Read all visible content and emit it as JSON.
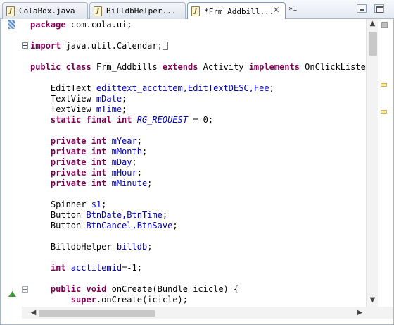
{
  "tabs": [
    {
      "label": "ColaBox.java",
      "icon": "java-file-icon",
      "active": false
    },
    {
      "label": "BilldbHelper...",
      "icon": "java-file-icon",
      "active": false
    },
    {
      "label": "*Frm_Addbill...",
      "icon": "java-file-icon",
      "active": true
    }
  ],
  "tab_overflow": "»1",
  "file_icon_glyph": "J",
  "close_glyph": "✕",
  "code": {
    "l1_kw": "package",
    "l1_rest": " com.cola.ui;",
    "l2_kw": "import",
    "l2_rest": " java.util.Calendar;",
    "l3_kw1": "public class",
    "l3_name": " Frm_Addbills ",
    "l3_kw2": "extends",
    "l3_mid": " Activity ",
    "l3_kw3": "implements",
    "l3_rest": " OnClickListener",
    "l4_type": "    EditText ",
    "l4_fields": "edittext_acctitem,EditTextDESC,Fee",
    "l4_end": ";",
    "l5_type": "    TextView ",
    "l5_field": "mDate",
    "l6_type": "    TextView ",
    "l6_field": "mTime",
    "l7_kw": "    static final int",
    "l7_field": " RG_REQUEST",
    "l7_rest": " = 0;",
    "private_kw": "    private int",
    "f_year": " mYear",
    "f_month": " mMonth",
    "f_day": " mDay",
    "f_hour": " mHour",
    "f_minute": " mMinute",
    "semi": ";",
    "l8_type": "    Spinner ",
    "l8_field": "s1",
    "l9_type": "    Button ",
    "l9_fields": "BtnDate,BtnTime",
    "l10_type": "    Button ",
    "l10_fields": "BtnCancel,BtnSave",
    "l11_type": "    BilldbHelper ",
    "l11_field": "billdb",
    "l12_kw": "    int",
    "l12_field": " acctitemid",
    "l12_rest": "=-1;",
    "l13_kw": "    public void",
    "l13_rest": " onCreate(Bundle icicle) {",
    "l14_kw": "        super",
    "l14_rest": ".onCreate(icicle);"
  }
}
